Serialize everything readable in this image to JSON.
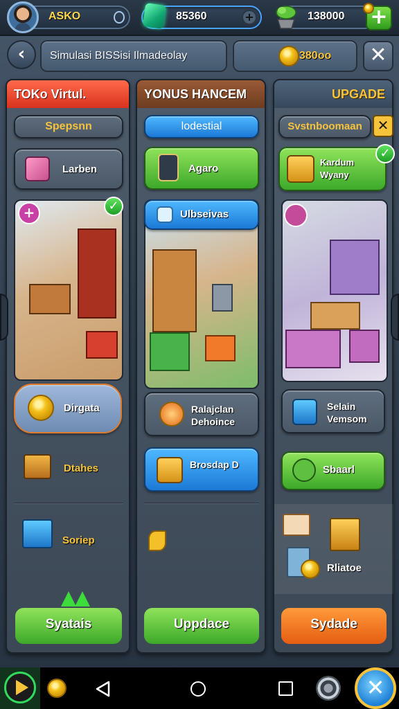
{
  "topbar": {
    "player_name": "ASKO",
    "gems": "85360",
    "plants": "138000"
  },
  "header": {
    "title": "Simulasi BISSisi Ilmadeolay",
    "coins": "380oo"
  },
  "panels": [
    {
      "title": "TOKo Virtul.",
      "subtitle": "Spepsnn",
      "items": [
        "Larben",
        "Dirgata",
        "Dtahes",
        "Soriep"
      ],
      "button": "Syatais"
    },
    {
      "title": "YONUS HANCEM",
      "subtitle": "lodestial",
      "items": [
        "Agaro",
        "Ulbseivas",
        "Ralajclan Dehoince",
        "Brosdap D"
      ],
      "button": "Uppdace"
    },
    {
      "title": "UPGADE",
      "subtitle": "Svstnboomaan",
      "items": [
        "Kardum Wyany",
        "Selain Vemsom",
        "Sbaarl",
        "Rliatoe"
      ],
      "button": "Sydade"
    }
  ],
  "colors": {
    "accent_red": "#e8402a",
    "accent_brown": "#7a4a2c",
    "accent_green": "#3da92a",
    "accent_blue": "#1c79d6",
    "accent_orange": "#e55d12",
    "gold_text": "#f6c33b"
  },
  "icons": [
    "player-avatar",
    "gem-icon",
    "plant-icon",
    "add-icon",
    "back-icon",
    "close-icon",
    "coin-icon",
    "play-icon",
    "back-nav-icon",
    "home-nav-icon",
    "recent-nav-icon",
    "settings-icon"
  ]
}
